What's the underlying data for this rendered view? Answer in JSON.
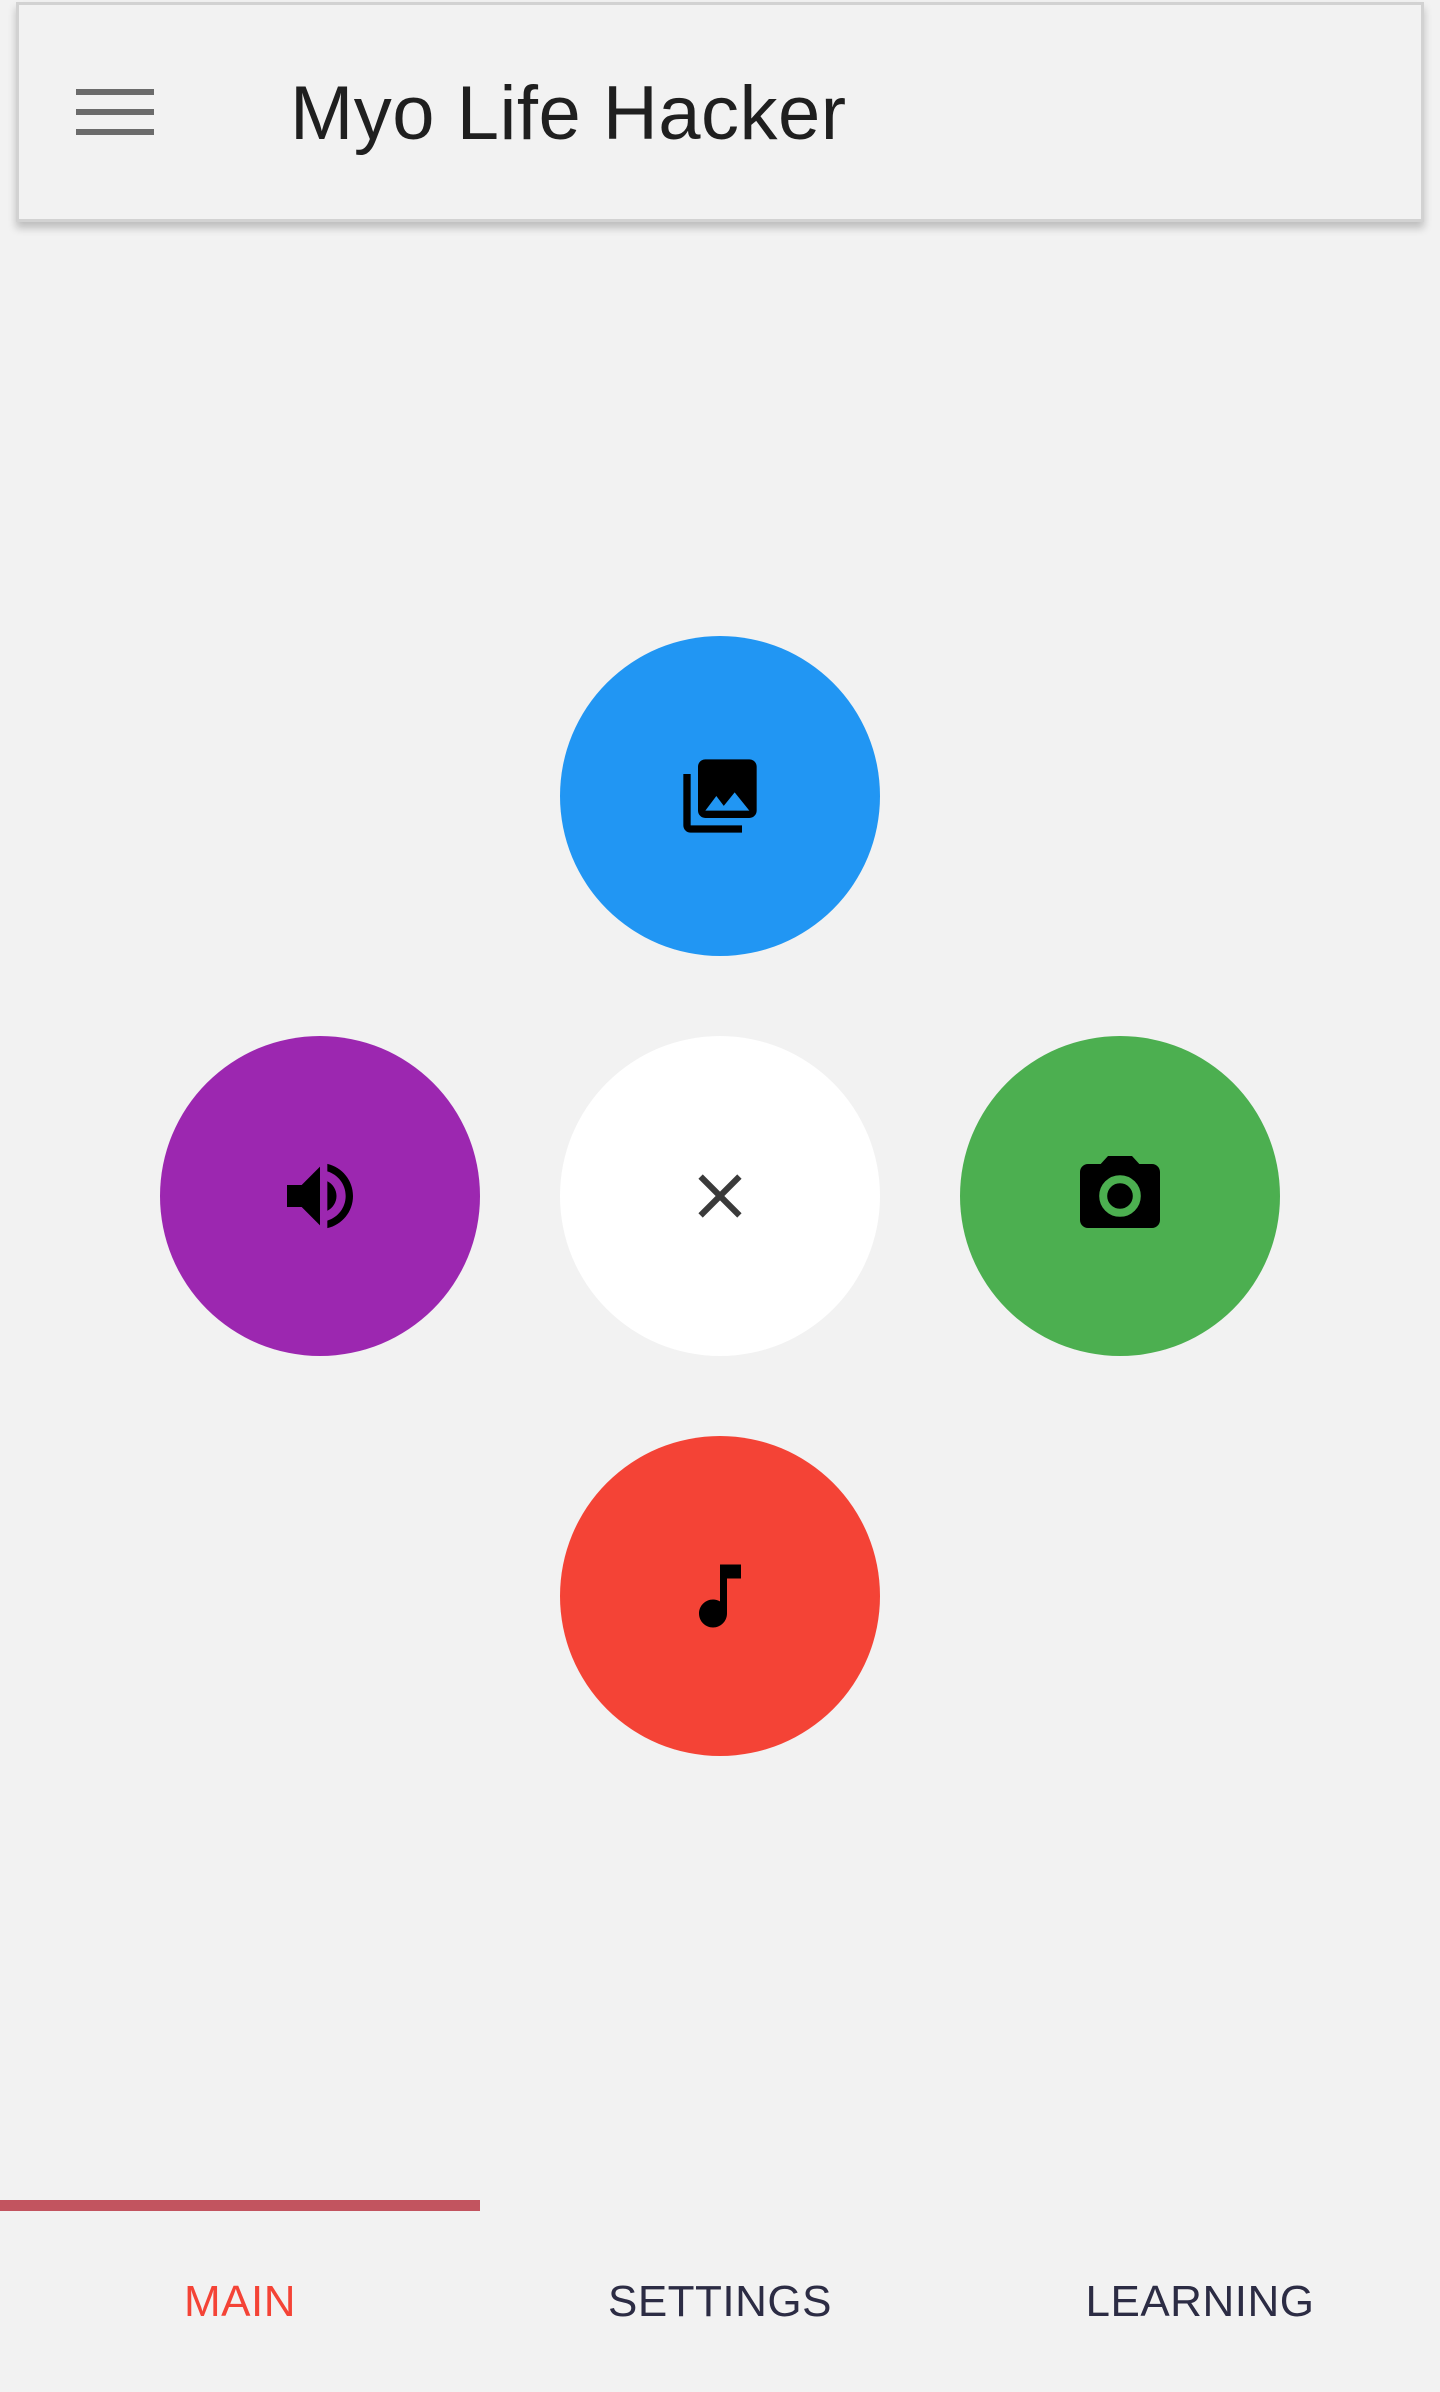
{
  "app_bar": {
    "title": "Myo Life Hacker",
    "menu_icon": "hamburger-menu-icon"
  },
  "actions": {
    "center": {
      "icon": "close-icon",
      "color": "#ffffff"
    },
    "top": {
      "icon": "photo-library-icon",
      "color": "#2196f3"
    },
    "left": {
      "icon": "volume-up-icon",
      "color": "#9c27b0"
    },
    "right": {
      "icon": "camera-icon",
      "color": "#4caf50"
    },
    "bottom": {
      "icon": "music-note-icon",
      "color": "#f44336"
    }
  },
  "tabs": {
    "items": [
      {
        "label": "MAIN",
        "selected": true
      },
      {
        "label": "SETTINGS",
        "selected": false
      },
      {
        "label": "LEARNING",
        "selected": false
      }
    ],
    "indicator_color": "#c2545f",
    "active_color": "#f44336",
    "inactive_color": "#2c2c44"
  }
}
